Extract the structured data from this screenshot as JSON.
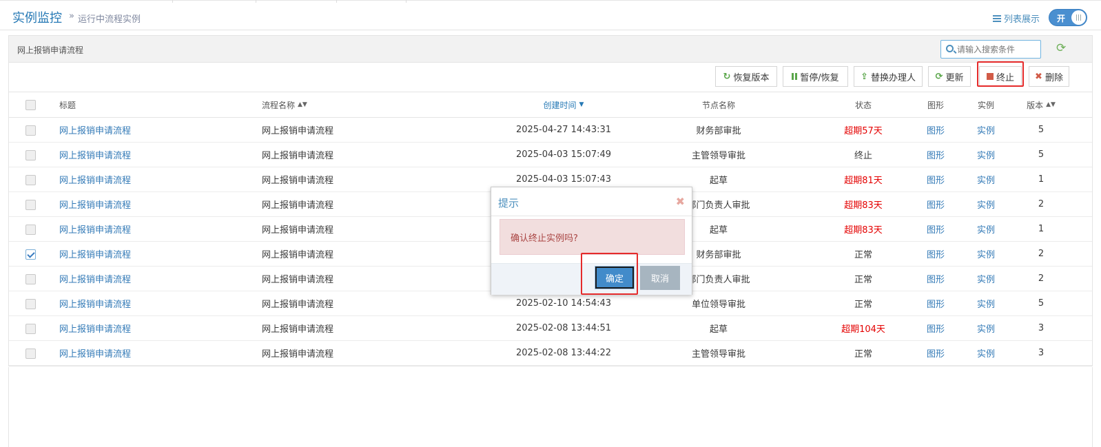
{
  "header": {
    "title": "实例监控",
    "crumb_arrow": "»",
    "subtitle": "运行中流程实例",
    "list_view_label": "列表展示",
    "toggle_label": "开"
  },
  "panel": {
    "title": "网上报销申请流程",
    "search_placeholder": "请输入搜索条件"
  },
  "toolbar": {
    "restore_label": "恢复版本",
    "pause_label": "暂停/恢复",
    "replace_label": "替换办理人",
    "update_label": "更新",
    "terminate_label": "终止",
    "delete_label": "删除"
  },
  "table": {
    "headers": {
      "title": "标题",
      "process_name": "流程名称",
      "created": "创建时间",
      "node": "节点名称",
      "status": "状态",
      "graph": "图形",
      "instance": "实例",
      "version": "版本"
    },
    "rows": [
      {
        "title": "网上报销申请流程",
        "process": "网上报销申请流程",
        "created": "2025-04-27 14:43:31",
        "node": "财务部审批",
        "status": "超期57天",
        "graph": "图形",
        "instance": "实例",
        "version": "5"
      },
      {
        "title": "网上报销申请流程",
        "process": "网上报销申请流程",
        "created": "2025-04-03 15:07:49",
        "node": "主管领导审批",
        "status": "终止",
        "graph": "图形",
        "instance": "实例",
        "version": "5"
      },
      {
        "title": "网上报销申请流程",
        "process": "网上报销申请流程",
        "created": "2025-04-03 15:07:43",
        "node": "起草",
        "status": "超期81天",
        "graph": "图形",
        "instance": "实例",
        "version": "1"
      },
      {
        "title": "网上报销申请流程",
        "process": "网上报销申请流程",
        "created": "",
        "node": "部门负责人审批",
        "status": "超期83天",
        "graph": "图形",
        "instance": "实例",
        "version": "2"
      },
      {
        "title": "网上报销申请流程",
        "process": "网上报销申请流程",
        "created": "",
        "node": "起草",
        "status": "超期83天",
        "graph": "图形",
        "instance": "实例",
        "version": "1"
      },
      {
        "title": "网上报销申请流程",
        "process": "网上报销申请流程",
        "created": "",
        "node": "财务部审批",
        "status": "正常",
        "graph": "图形",
        "instance": "实例",
        "version": "2"
      },
      {
        "title": "网上报销申请流程",
        "process": "网上报销申请流程",
        "created": "",
        "node": "部门负责人审批",
        "status": "正常",
        "graph": "图形",
        "instance": "实例",
        "version": "2"
      },
      {
        "title": "网上报销申请流程",
        "process": "网上报销申请流程",
        "created": "2025-02-10 14:54:43",
        "node": "单位领导审批",
        "status": "正常",
        "graph": "图形",
        "instance": "实例",
        "version": "5"
      },
      {
        "title": "网上报销申请流程",
        "process": "网上报销申请流程",
        "created": "2025-02-08 13:44:51",
        "node": "起草",
        "status": "超期104天",
        "graph": "图形",
        "instance": "实例",
        "version": "3"
      },
      {
        "title": "网上报销申请流程",
        "process": "网上报销申请流程",
        "created": "2025-02-08 13:44:22",
        "node": "主管领导审批",
        "status": "正常",
        "graph": "图形",
        "instance": "实例",
        "version": "3"
      }
    ]
  },
  "dialog": {
    "title": "提示",
    "message": "确认终止实例吗?",
    "ok_label": "确定",
    "cancel_label": "取消"
  },
  "colors": {
    "accent": "#2679b5",
    "link": "#337ab7",
    "overdue": "#e40000",
    "highlight": "#e52a2a",
    "primary_button": "#428bca"
  }
}
